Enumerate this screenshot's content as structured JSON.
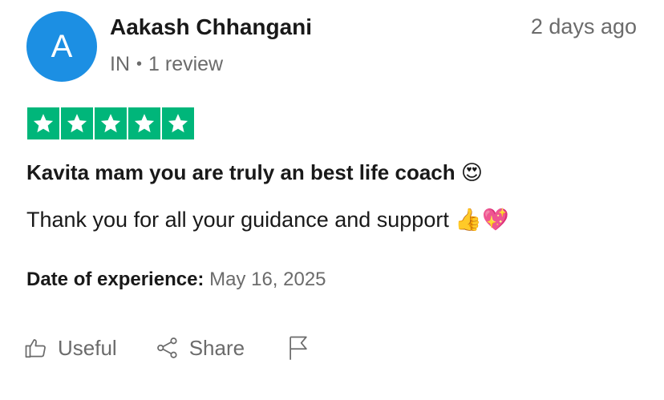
{
  "reviewer": {
    "initial": "A",
    "name": "Aakash Chhangani",
    "country": "IN",
    "separator": "•",
    "review_count": "1 review",
    "avatar_color": "#1c8fe3"
  },
  "posted": "2 days ago",
  "rating": {
    "stars": 5,
    "max": 5,
    "color": "#00b67a"
  },
  "review": {
    "title": "Kavita mam you are truly an best life coach",
    "title_emoji": "😍",
    "body": "Thank you for all your guidance and support",
    "body_emoji": "👍💖"
  },
  "experience": {
    "label": "Date of experience:",
    "date": "May 16, 2025"
  },
  "actions": {
    "useful_label": "Useful",
    "useful_icon": "thumbs-up-icon",
    "share_label": "Share",
    "share_icon": "share-icon",
    "report_icon": "flag-icon"
  }
}
